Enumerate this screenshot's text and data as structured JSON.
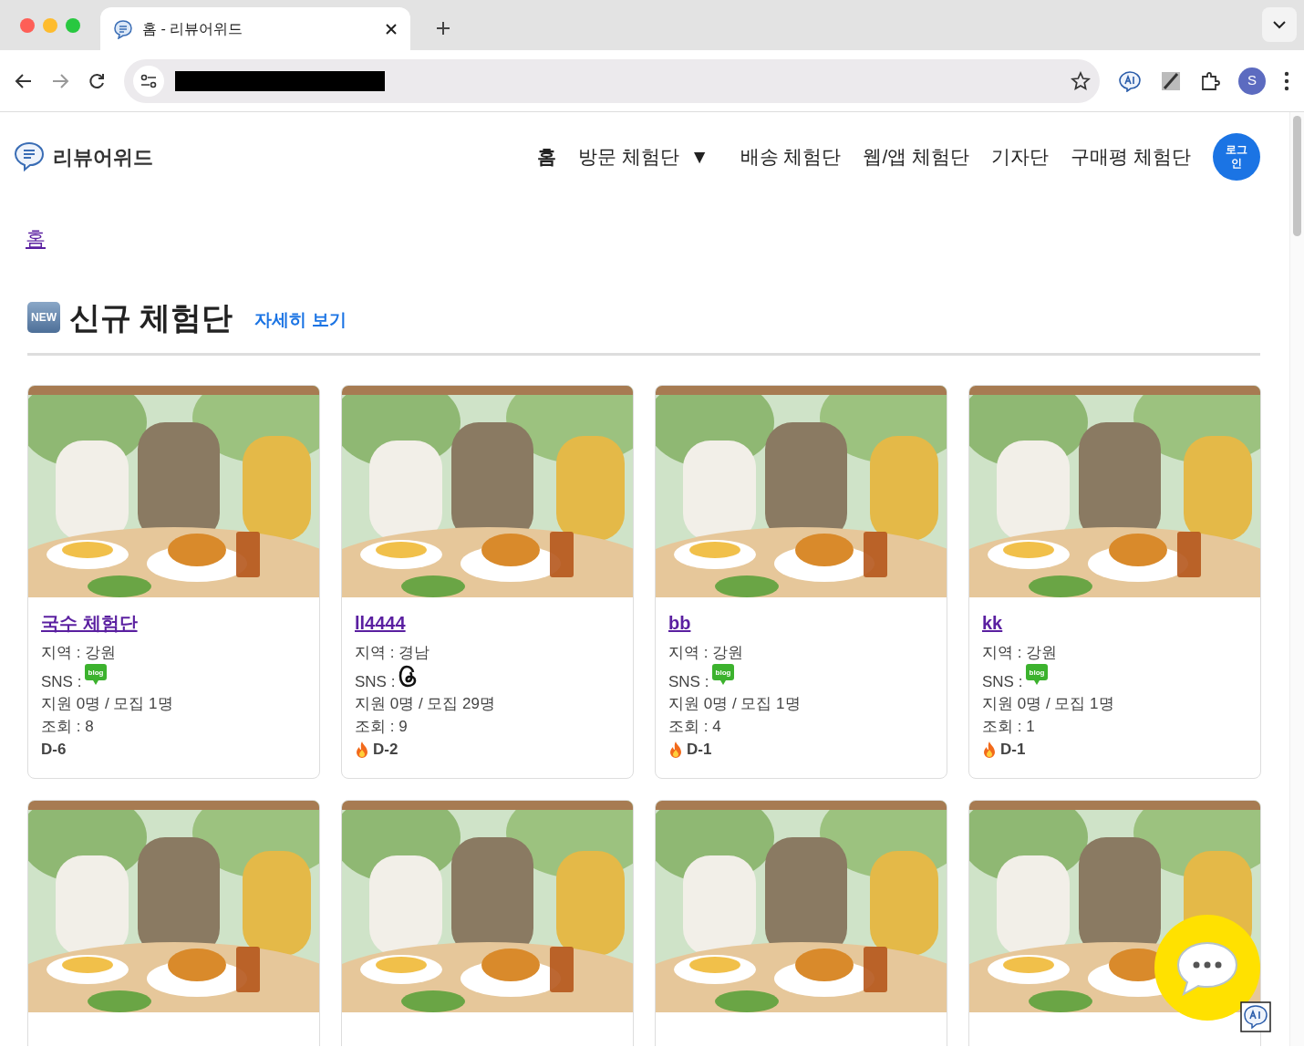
{
  "browser": {
    "tab_title": "홈 - 리뷰어위드",
    "profile_initial": "S"
  },
  "site": {
    "logo_text": "리뷰어위드",
    "nav": [
      {
        "label": "홈",
        "selected": true,
        "kind": "link"
      },
      {
        "label": "방문 체험단",
        "selected": false,
        "kind": "dropdown",
        "caret": "▼"
      },
      {
        "label": "배송 체험단",
        "selected": false,
        "kind": "link"
      },
      {
        "label": "웹/앱 체험단",
        "selected": false,
        "kind": "link"
      },
      {
        "label": "기자단",
        "selected": false,
        "kind": "link"
      },
      {
        "label": "구매평 체험단",
        "selected": false,
        "kind": "link"
      }
    ],
    "login_button": "로그인"
  },
  "breadcrumb": "홈",
  "section": {
    "badge": "NEW",
    "title": "신규 체험단",
    "more_link": "자세히 보기"
  },
  "cards": [
    {
      "kind": "campaign",
      "title": "국수 체험단",
      "region": "지역 : 강원",
      "sns_label": "SNS :",
      "sns": {
        "kind": "blog",
        "text": "blog"
      },
      "applicants": "지원 0명 / 모집 1명",
      "views": "조회 : 8",
      "hot": false,
      "dday": "D-6"
    },
    {
      "kind": "campaign",
      "title": "ll4444",
      "region": "지역 : 경남",
      "sns_label": "SNS :",
      "sns": {
        "kind": "threads"
      },
      "applicants": "지원 0명 / 모집 29명",
      "views": "조회 : 9",
      "hot": true,
      "dday": "D-2"
    },
    {
      "kind": "campaign",
      "title": "bb",
      "region": "지역 : 강원",
      "sns_label": "SNS :",
      "sns": {
        "kind": "blog",
        "text": "blog"
      },
      "applicants": "지원 0명 / 모집 1명",
      "views": "조회 : 4",
      "hot": true,
      "dday": "D-1"
    },
    {
      "kind": "campaign",
      "title": "kk",
      "region": "지역 : 강원",
      "sns_label": "SNS :",
      "sns": {
        "kind": "blog",
        "text": "blog"
      },
      "applicants": "지원 0명 / 모집 1명",
      "views": "조회 : 1",
      "hot": true,
      "dday": "D-1"
    },
    {
      "kind": "picture"
    },
    {
      "kind": "picture"
    },
    {
      "kind": "picture"
    },
    {
      "kind": "picture"
    }
  ]
}
